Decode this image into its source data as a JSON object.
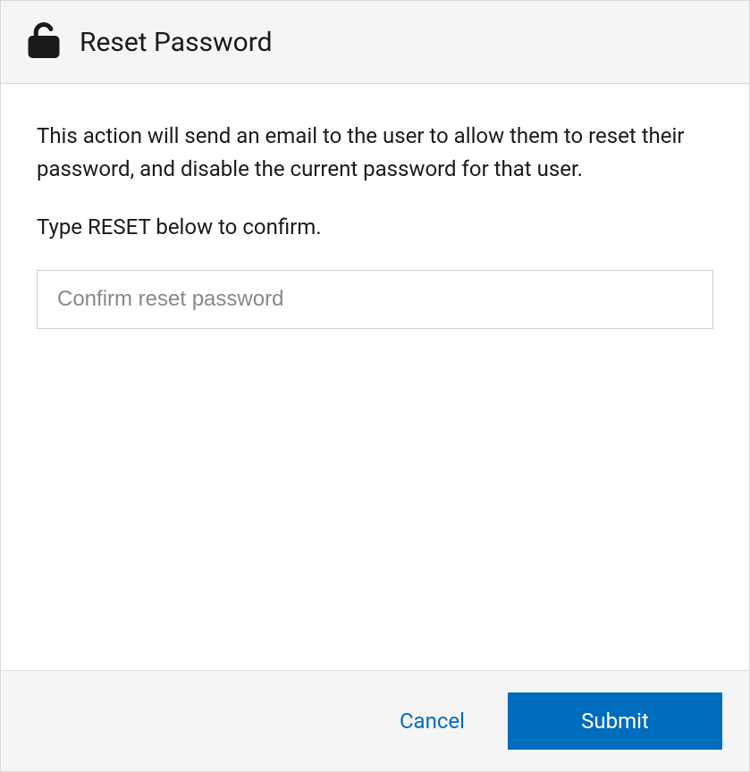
{
  "header": {
    "icon": "unlock-icon",
    "title": "Reset Password"
  },
  "body": {
    "description": "This action will send an email to the user to allow them to reset their password, and disable the current password for that user.",
    "instruction": "Type RESET below to confirm.",
    "input": {
      "placeholder": "Confirm reset password",
      "value": ""
    }
  },
  "footer": {
    "cancel_label": "Cancel",
    "submit_label": "Submit"
  }
}
